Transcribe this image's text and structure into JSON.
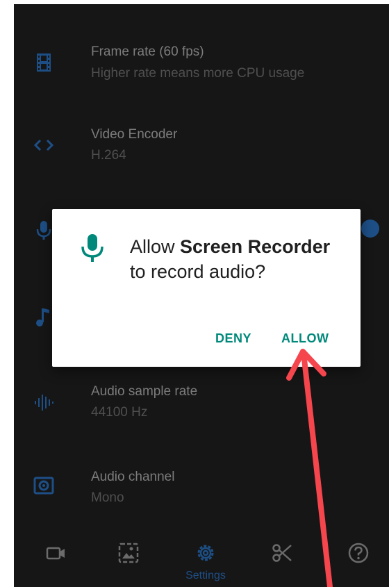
{
  "settings": [
    {
      "title": "Frame rate (60 fps)",
      "subtitle": "Higher rate means more CPU usage",
      "icon": "film-icon"
    },
    {
      "title": "Video Encoder",
      "subtitle": "H.264",
      "icon": "code-icon"
    },
    {
      "title": "",
      "subtitle": "",
      "icon": "microphone-icon",
      "toggle": true
    },
    {
      "title": "",
      "subtitle": "",
      "icon": "music-note-icon"
    },
    {
      "title": "Audio sample rate",
      "subtitle": "44100 Hz",
      "icon": "waveform-icon"
    },
    {
      "title": "Audio channel",
      "subtitle": "Mono",
      "icon": "speaker-icon"
    }
  ],
  "dialog": {
    "icon": "microphone-icon",
    "prefix": "Allow ",
    "app_name": "Screen Recorder",
    "suffix": " to record audio?",
    "deny_label": "DENY",
    "allow_label": "ALLOW"
  },
  "bottom_nav": [
    {
      "name": "videos",
      "icon": "video-camera-icon",
      "label": ""
    },
    {
      "name": "images",
      "icon": "image-icon",
      "label": ""
    },
    {
      "name": "settings",
      "icon": "gear-icon",
      "label": "Settings",
      "active": true
    },
    {
      "name": "edit",
      "icon": "scissors-icon",
      "label": ""
    },
    {
      "name": "help",
      "icon": "help-icon",
      "label": ""
    }
  ],
  "colors": {
    "background": "#161616",
    "icon_blue": "#1d4f86",
    "dialog_accent": "#00897b",
    "annotation_arrow": "#f5454d"
  }
}
